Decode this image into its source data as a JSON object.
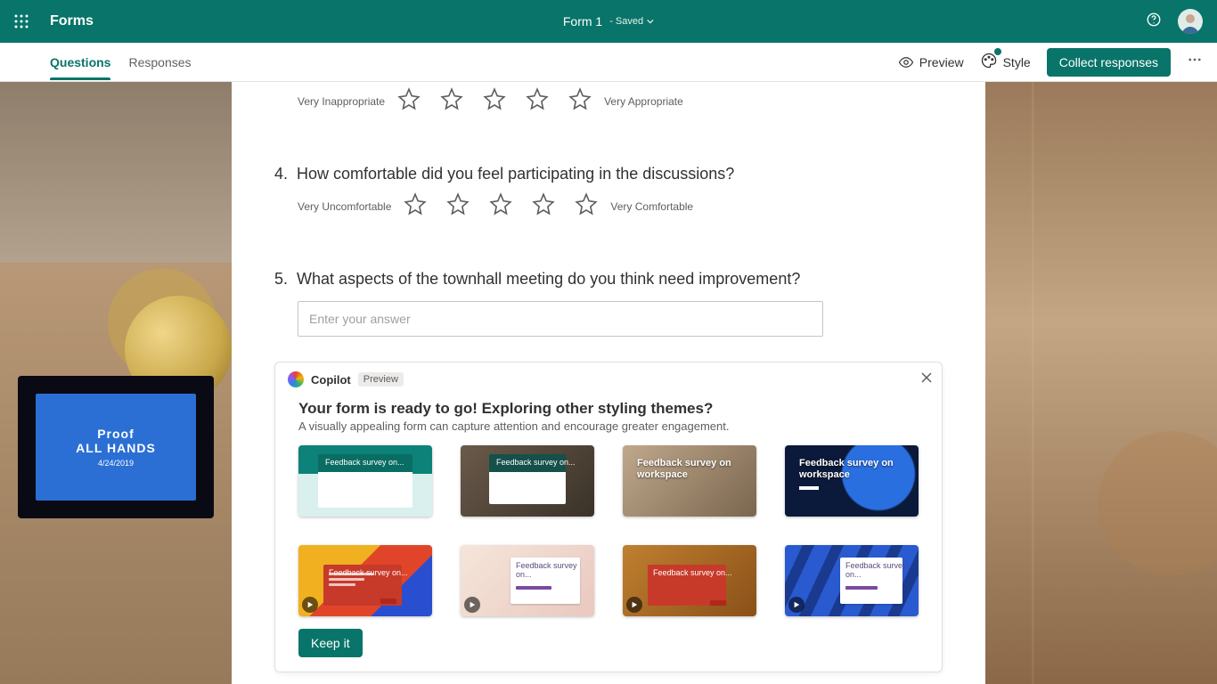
{
  "header": {
    "brand": "Forms",
    "form_title": "Form 1",
    "saved_label": "- Saved"
  },
  "toolbar": {
    "tabs": {
      "questions": "Questions",
      "responses": "Responses"
    },
    "preview": "Preview",
    "style": "Style",
    "collect": "Collect responses"
  },
  "bg": {
    "monitor": {
      "line1": "Proof",
      "line2": "ALL HANDS",
      "line3": "4/24/2019"
    }
  },
  "questions": {
    "q3": {
      "left_label": "Very Inappropriate",
      "right_label": "Very Appropriate"
    },
    "q4": {
      "number": "4.",
      "text": "How comfortable did you feel participating in the discussions?",
      "left_label": "Very Uncomfortable",
      "right_label": "Very Comfortable"
    },
    "q5": {
      "number": "5.",
      "text": "What aspects of the townhall meeting do you think need improvement?",
      "placeholder": "Enter your answer"
    }
  },
  "copilot": {
    "name": "Copilot",
    "badge": "Preview",
    "title": "Your form is ready to go! Exploring other styling themes?",
    "subtitle": "A visually appealing form can capture attention and encourage greater engagement.",
    "tiles": {
      "t1": "Feedback survey on...",
      "t2": "Feedback survey on...",
      "t3": "Feedback survey on workspace",
      "t4": "Feedback survey on workspace",
      "t5": "Feedback survey on...",
      "t6": "Feedback survey on...",
      "t7": "Feedback survey on...",
      "t8": "Feedback survey on..."
    },
    "keep": "Keep it"
  }
}
